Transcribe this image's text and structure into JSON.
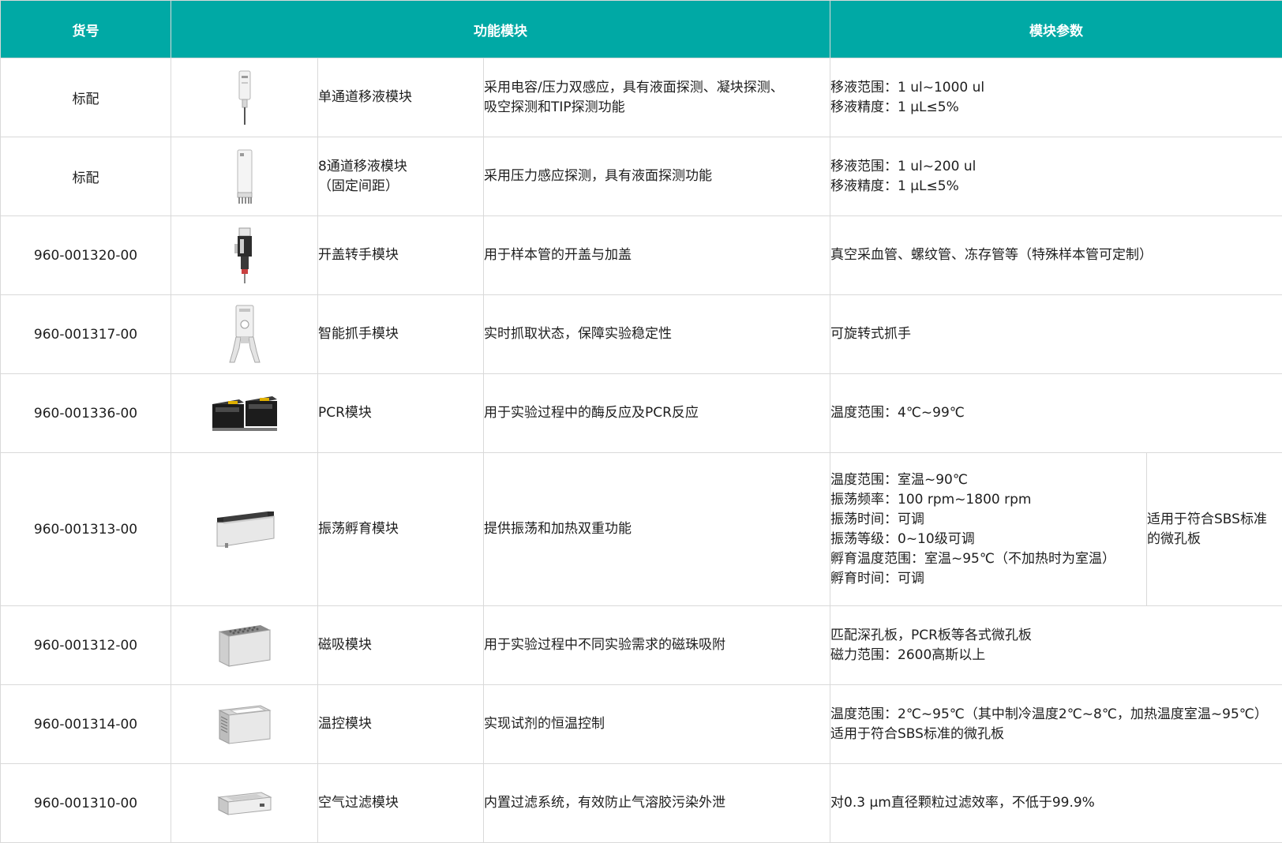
{
  "header": {
    "col_sku": "货号",
    "col_module": "功能模块",
    "col_params": "模块参数"
  },
  "rows": [
    {
      "sku": "标配",
      "image_icon": "single-channel-pipette-icon",
      "name": [
        "单通道移液模块"
      ],
      "func": [
        "采用电容/压力双感应，具有液面探测、凝块探测、",
        "吸空探测和TIP探测功能"
      ],
      "params": [
        "移液范围：1 ul~1000 ul",
        "移液精度：1 μL≤5%"
      ]
    },
    {
      "sku": "标配",
      "image_icon": "eight-channel-pipette-icon",
      "name": [
        "8通道移液模块",
        "（固定间距）"
      ],
      "func": [
        "采用压力感应探测，具有液面探测功能"
      ],
      "params": [
        "移液范围：1 ul~200 ul",
        "移液精度：1 μL≤5%"
      ]
    },
    {
      "sku": "960-001320-00",
      "image_icon": "cap-gripper-icon",
      "name": [
        "开盖转手模块"
      ],
      "func": [
        "用于样本管的开盖与加盖"
      ],
      "params": [
        "真空采血管、螺纹管、冻存管等（特殊样本管可定制）"
      ]
    },
    {
      "sku": "960-001317-00",
      "image_icon": "smart-gripper-icon",
      "name": [
        "智能抓手模块"
      ],
      "func": [
        "实时抓取状态，保障实验稳定性"
      ],
      "params": [
        "可旋转式抓手"
      ]
    },
    {
      "sku": "960-001336-00",
      "image_icon": "pcr-module-icon",
      "name": [
        "PCR模块"
      ],
      "func": [
        "用于实验过程中的酶反应及PCR反应"
      ],
      "params": [
        "温度范围：4℃~99℃"
      ]
    },
    {
      "sku": "960-001313-00",
      "image_icon": "shaker-incubator-icon",
      "name": [
        "振荡孵育模块"
      ],
      "func": [
        "提供振荡和加热双重功能"
      ],
      "params": [
        "温度范围：室温~90℃",
        "振荡频率：100 rpm~1800 rpm",
        "振荡时间：可调",
        "振荡等级：0~10级可调",
        "孵育温度范围：室温~95℃（不加热时为室温）",
        "孵育时间：可调"
      ],
      "note": [
        "适用于符合SBS标准",
        "的微孔板"
      ]
    },
    {
      "sku": "960-001312-00",
      "image_icon": "magnetic-module-icon",
      "name": [
        "磁吸模块"
      ],
      "func": [
        "用于实验过程中不同实验需求的磁珠吸附"
      ],
      "params": [
        "匹配深孔板，PCR板等各式微孔板",
        "磁力范围：2600高斯以上"
      ]
    },
    {
      "sku": "960-001314-00",
      "image_icon": "temperature-control-icon",
      "name": [
        "温控模块"
      ],
      "func": [
        "实现试剂的恒温控制"
      ],
      "params": [
        "温度范围：2℃~95℃（其中制冷温度2℃~8℃，加热温度室温~95℃）",
        "适用于符合SBS标准的微孔板"
      ]
    },
    {
      "sku": "960-001310-00",
      "image_icon": "air-filter-icon",
      "name": [
        "空气过滤模块"
      ],
      "func": [
        "内置过滤系统，有效防止气溶胶污染外泄"
      ],
      "params": [
        "对0.3 μm直径颗粒过滤效率，不低于99.9%"
      ]
    }
  ],
  "colors": {
    "header_bg": "#00a9a5",
    "header_text": "#ffffff",
    "border": "#d9d9d9",
    "text": "#1e1e1e"
  }
}
